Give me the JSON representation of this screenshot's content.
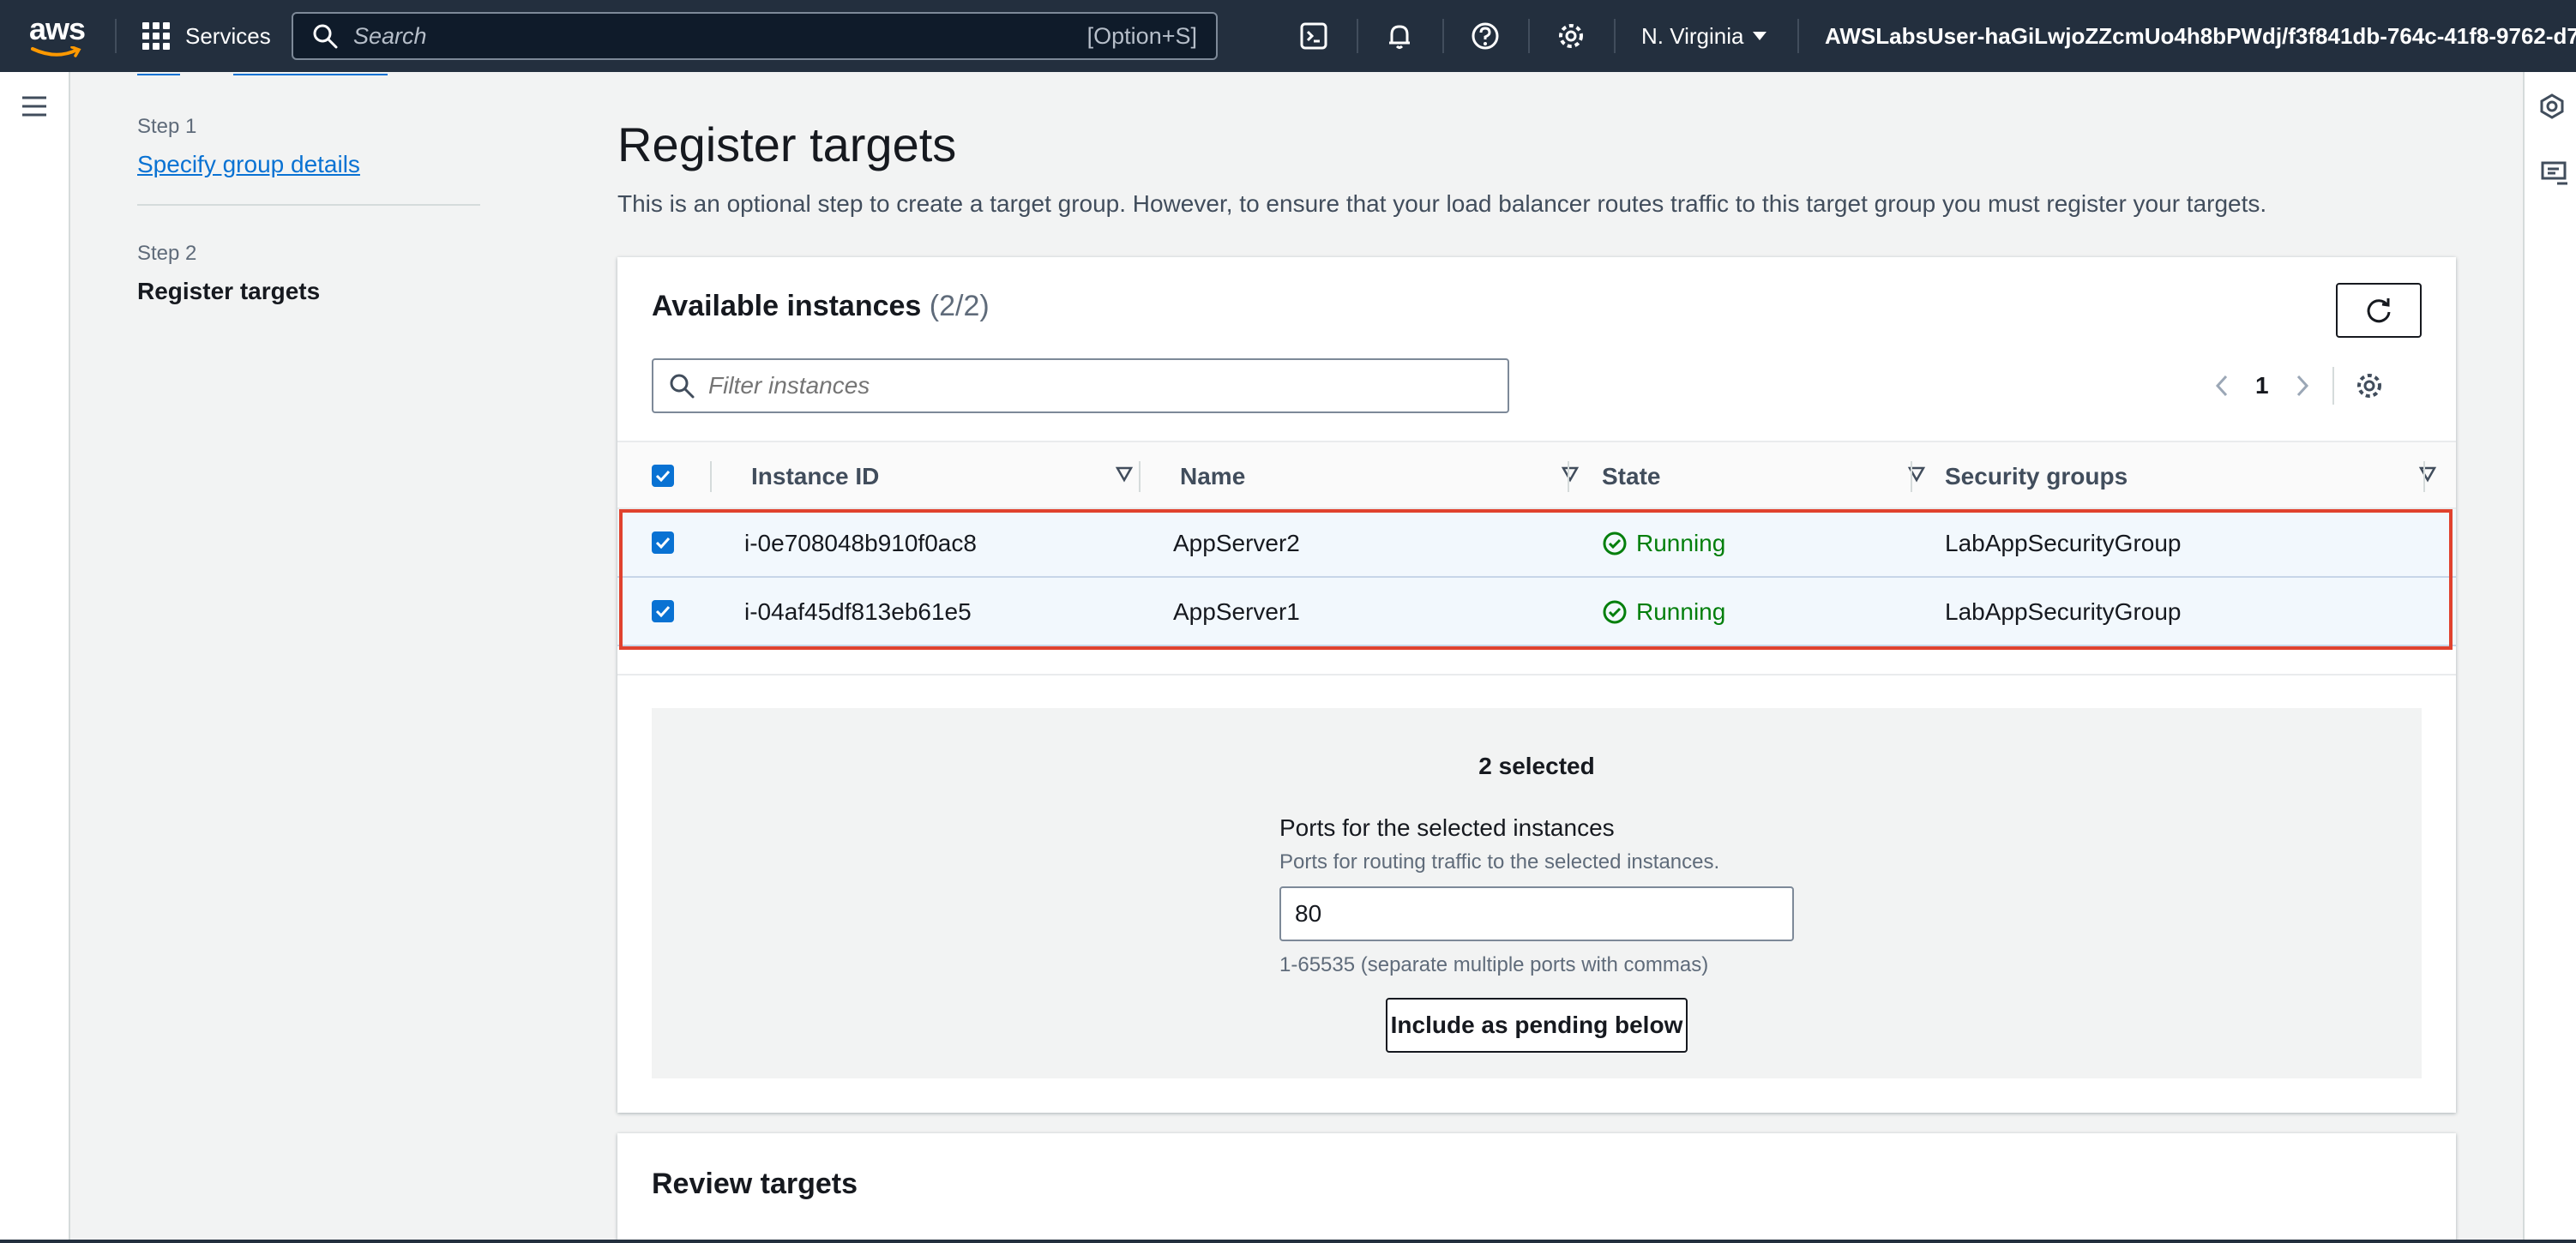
{
  "nav": {
    "logo": "aws",
    "services_label": "Services",
    "search_placeholder": "Search",
    "search_shortcut": "[Option+S]",
    "region": "N. Virginia",
    "account": "AWSLabsUser-haGiLwjoZZcmUo4h8bPWdj/f3f841db-764c-41f8-9762-d7...",
    "icons": [
      "cloudshell-icon",
      "bell-icon",
      "help-icon",
      "gear-icon"
    ]
  },
  "steps": [
    {
      "label": "Step 1",
      "title": "Specify group details",
      "active": false
    },
    {
      "label": "Step 2",
      "title": "Register targets",
      "active": true
    }
  ],
  "page": {
    "title": "Register targets",
    "description": "This is an optional step to create a target group. However, to ensure that your load balancer routes traffic to this target group you must register your targets."
  },
  "instances": {
    "title": "Available instances",
    "count": "(2/2)",
    "filter_placeholder": "Filter instances",
    "page_number": "1",
    "columns": [
      "Instance ID",
      "Name",
      "State",
      "Security groups"
    ],
    "rows": [
      {
        "id": "i-0e708048b910f0ac8",
        "name": "AppServer2",
        "state": "Running",
        "sg": "LabAppSecurityGroup",
        "checked": true
      },
      {
        "id": "i-04af45df813eb61e5",
        "name": "AppServer1",
        "state": "Running",
        "sg": "LabAppSecurityGroup",
        "checked": true
      }
    ],
    "selected_text": "2 selected",
    "ports_label": "Ports for the selected instances",
    "ports_description": "Ports for routing traffic to the selected instances.",
    "ports_value": "80",
    "ports_hint": "1-65535 (separate multiple ports with commas)",
    "include_button": "Include as pending below"
  },
  "review": {
    "title": "Review targets"
  },
  "colors": {
    "nav_bg": "#232f3e",
    "link": "#0972d3",
    "running": "#037f0c",
    "highlight": "#e0422e"
  }
}
